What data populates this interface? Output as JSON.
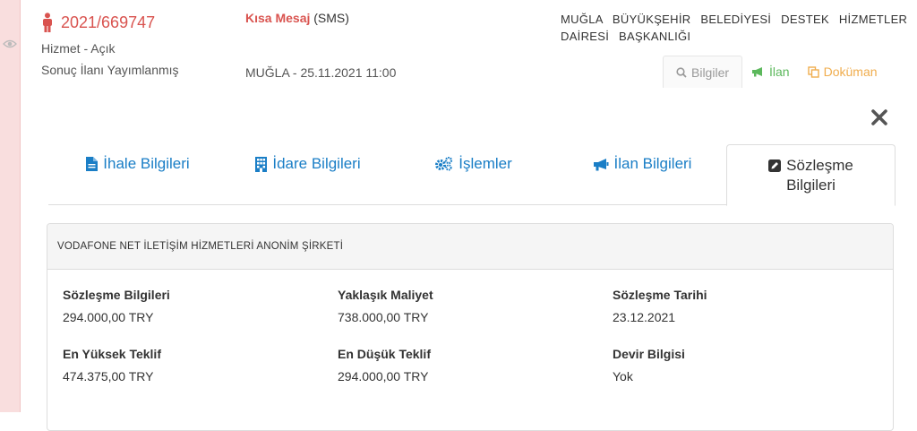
{
  "header": {
    "ihale_no": "2021/669747",
    "tur_durum": "Hizmet - Açık",
    "durum": "Sonuç İlanı Yayımlanmış",
    "kisa_mesaj_label": "Kısa Mesaj",
    "kisa_mesaj_suffix": "(SMS)",
    "location_date": "MUĞLA - 25.11.2021 11:00",
    "idare": "MUĞLA BÜYÜKŞEHİR BELEDİYESİ DESTEK HİZMETLER DAİRESİ BAŞKANLIĞI",
    "actions": {
      "bilgiler": "Bilgiler",
      "ilan": "İlan",
      "dokuman": "Doküman"
    }
  },
  "tabs": [
    {
      "label": "İhale Bilgileri",
      "icon": "file-icon"
    },
    {
      "label": "İdare Bilgileri",
      "icon": "building-icon"
    },
    {
      "label": "İşlemler",
      "icon": "gears-icon"
    },
    {
      "label": "İlan Bilgileri",
      "icon": "bullhorn-icon"
    },
    {
      "label_line1": "Sözleşme",
      "label_line2": "Bilgileri",
      "icon": "edit-icon",
      "active": true
    }
  ],
  "contract": {
    "company": "VODAFONE NET İLETİŞİM HİZMETLERİ ANONİM ŞİRKETİ",
    "fields": [
      {
        "label": "Sözleşme Bilgileri",
        "value": "294.000,00 TRY"
      },
      {
        "label": "Yaklaşık Maliyet",
        "value": "738.000,00 TRY"
      },
      {
        "label": "Sözleşme Tarihi",
        "value": "23.12.2021"
      },
      {
        "label": "En Yüksek Teklif",
        "value": "474.375,00 TRY"
      },
      {
        "label": "En Düşük Teklif",
        "value": "294.000,00 TRY"
      },
      {
        "label": "Devir Bilgisi",
        "value": "Yok"
      }
    ]
  },
  "colors": {
    "accent_red": "#d9534f",
    "link_blue": "#1a7ec6",
    "ilan_green": "#5cb85c",
    "dokuman_orange": "#f0ad4e"
  }
}
